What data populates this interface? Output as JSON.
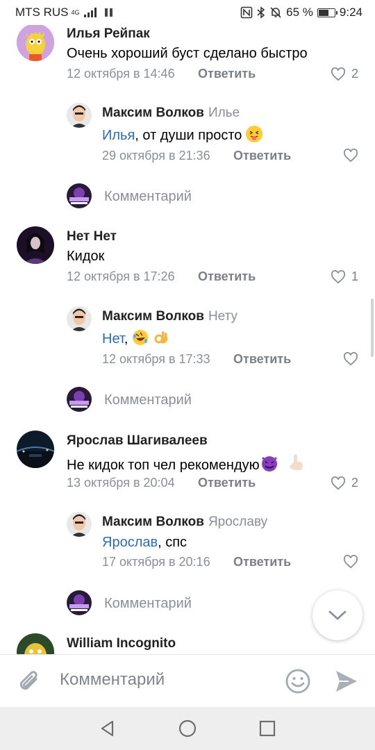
{
  "status_bar": {
    "carrier": "MTS RUS",
    "network": "4G",
    "battery": "65 %",
    "battery_level": 0.65,
    "time": "9:24"
  },
  "comments": [
    {
      "author": "Илья Рейпак",
      "text": "Очень хороший буст сделано быстро",
      "date": "12 октября в 14:46",
      "reply_label": "Ответить",
      "likes": "2"
    },
    {
      "author": "Максим Волков",
      "reply_to": "Илье",
      "mention": "Илья",
      "text_after": ", от души просто",
      "date": "29 октября в 21:36",
      "reply_label": "Ответить"
    },
    {
      "author": "Нет Нет",
      "text": "Кидок",
      "date": "12 октября в 17:26",
      "reply_label": "Ответить",
      "likes": "1"
    },
    {
      "author": "Максим Волков",
      "reply_to": "Нету",
      "mention": "Нет",
      "text_after": ",",
      "date": "12 октября в 17:33",
      "reply_label": "Ответить"
    },
    {
      "author": "Ярослав Шагивалеев",
      "text": "Не кидок топ чел рекомендую",
      "date": "13 октября в 20:04",
      "reply_label": "Ответить",
      "likes": "2"
    },
    {
      "author": "Максим Волков",
      "reply_to": "Ярославу",
      "mention": "Ярослав",
      "text_after": ", спс",
      "date": "17 октября в 20:16",
      "reply_label": "Ответить"
    },
    {
      "author": "William Incognito"
    }
  ],
  "comment_prompt": "Комментарий",
  "input": {
    "placeholder": "Комментарий"
  },
  "colors": {
    "link": "#2b6cb8",
    "meta": "#8a8f96",
    "send": "#a9b0b8"
  }
}
